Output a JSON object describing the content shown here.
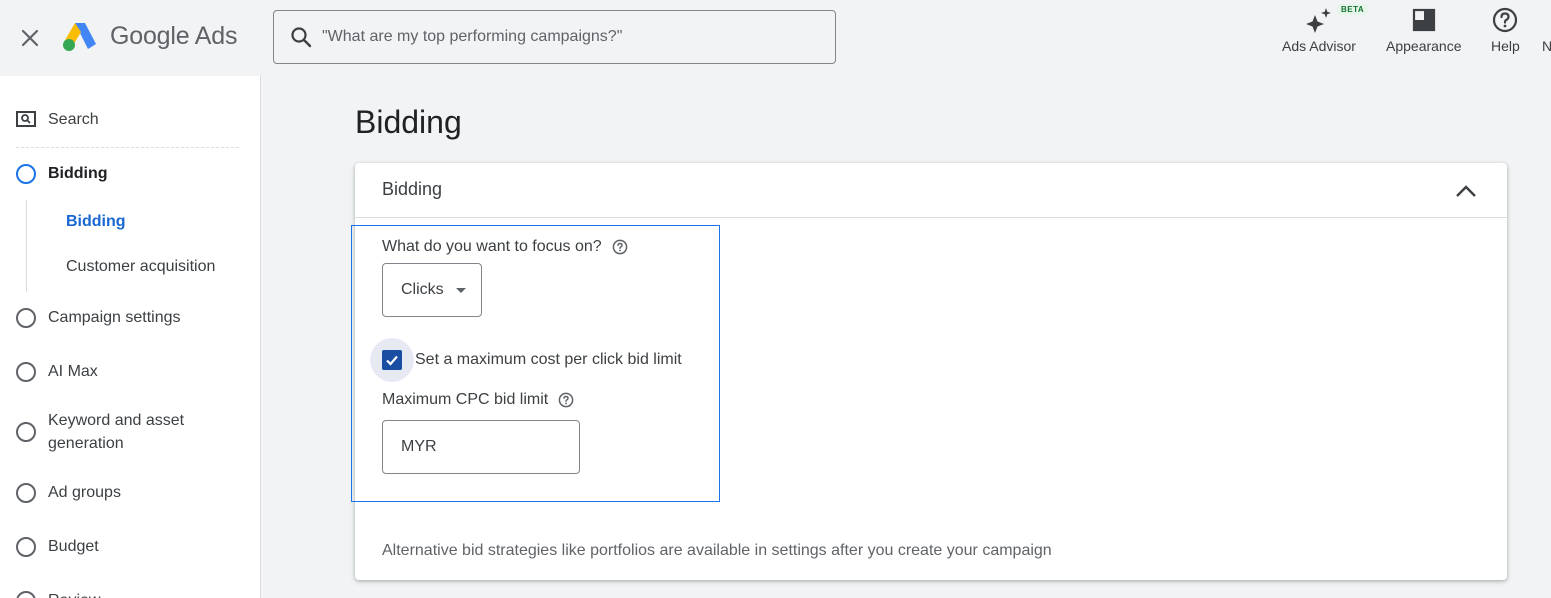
{
  "header": {
    "logo_text": "Google Ads",
    "search_placeholder": "\"What are my top performing campaigns?\"",
    "actions": {
      "ads_advisor": "Ads Advisor",
      "beta_badge": "BETA",
      "appearance": "Appearance",
      "help": "Help",
      "cut_off": "N"
    }
  },
  "sidebar": {
    "search_label": "Search",
    "items": [
      {
        "label": "Bidding",
        "active": true
      },
      {
        "label": "Campaign settings"
      },
      {
        "label": "AI Max"
      },
      {
        "label": "Keyword and asset generation"
      },
      {
        "label": "Ad groups"
      },
      {
        "label": "Budget"
      },
      {
        "label": "Review"
      }
    ],
    "subitems": [
      {
        "label": "Bidding",
        "active": true
      },
      {
        "label": "Customer acquisition"
      }
    ]
  },
  "main": {
    "page_title": "Bidding",
    "card": {
      "title": "Bidding",
      "focus_question": "What do you want to focus on?",
      "focus_value": "Clicks",
      "checkbox_label": "Set a maximum cost per click bid limit",
      "checkbox_checked": true,
      "cpc_label": "Maximum CPC bid limit",
      "cpc_currency": "MYR",
      "cpc_value": "",
      "footnote": "Alternative bid strategies like portfolios are available in settings after you create your campaign"
    }
  },
  "colors": {
    "accent": "#1a73e8",
    "checkbox": "#1a4ea3",
    "active_text": "#1967d2"
  },
  "icons": [
    "close-icon",
    "google-ads-logo-icon",
    "search-icon",
    "sparkle-icon",
    "appearance-icon",
    "help-circle-icon",
    "search-panel-icon",
    "radio-circle-icon",
    "chevron-up-icon",
    "help-outline-icon",
    "dropdown-caret-icon",
    "checkmark-icon"
  ]
}
